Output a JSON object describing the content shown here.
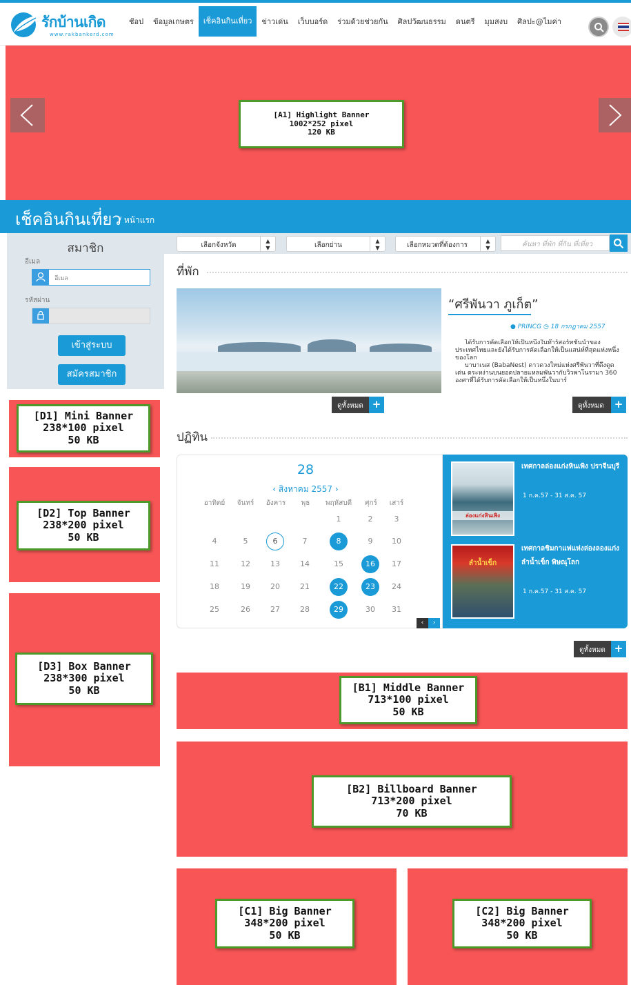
{
  "header": {
    "logo_text": "รักบ้านเกิด",
    "logo_url": "www.rakbankerd.com",
    "nav": [
      {
        "label": "ช้อป"
      },
      {
        "label": "ข้อมูลเกษตร"
      },
      {
        "label": "เช็คอินกินเที่ยว",
        "active": true
      },
      {
        "label": "ข่าวเด่น"
      },
      {
        "label": "เว็บบอร์ด"
      },
      {
        "label": "ร่วมด้วยช่วยกัน"
      },
      {
        "label": "ศิลปวัฒนธรรม"
      },
      {
        "label": "ดนตรี"
      },
      {
        "label": "มุมสงบ"
      },
      {
        "label": "ศิลปะ@ไมค่า"
      }
    ],
    "search_icon": "search-icon",
    "language_icon": "thai-flag-icon"
  },
  "banners": {
    "A1": {
      "name": "[A1] Highlight Banner",
      "size": "1002*252 pixel",
      "weight": "120 KB"
    },
    "D1": {
      "name": "[D1] Mini Banner",
      "size": "238*100 pixel",
      "weight": "50 KB"
    },
    "D2": {
      "name": "[D2] Top Banner",
      "size": "238*200 pixel",
      "weight": "50 KB"
    },
    "D3": {
      "name": "[D3] Box Banner",
      "size": "238*300 pixel",
      "weight": "50 KB"
    },
    "B1": {
      "name": "[B1] Middle Banner",
      "size": "713*100 pixel",
      "weight": "50 KB"
    },
    "B2": {
      "name": "[B2] Billboard Banner",
      "size": "713*200 pixel",
      "weight": "70 KB"
    },
    "C1": {
      "name": "[C1] Big Banner",
      "size": "348*200 pixel",
      "weight": "50 KB"
    },
    "C2": {
      "name": "[C2] Big Banner",
      "size": "348*200 pixel",
      "weight": "50 KB"
    }
  },
  "page": {
    "title": "เช็คอินกินเที่ยว",
    "breadcrumb": "/ หน้าแรก"
  },
  "member": {
    "title": "สมาชิก",
    "email_label": "อีเมล",
    "email_placeholder": "อีเมล",
    "password_label": "รหัสผ่าน",
    "login_label": "เข้าสู่ระบบ",
    "register_label": "สมัครสมาชิก"
  },
  "filters": {
    "province": "เลือกจังหวัด",
    "area": "เลือกย่าน",
    "category": "เลือกหมวดที่ต้องการ",
    "search_placeholder": "ค้นหา ที่พัก ที่กิน ที่เที่ยว"
  },
  "lodging": {
    "heading": "ที่พัก",
    "title": "“ศรีพันวา ภูเก็ต”",
    "author": "PRINCG",
    "date": "18 กรกฎาคม 2557",
    "body_p1": "ได้รับการคัดเลือกให้เป็นหนึ่งในท๊าร์สอร์ทชั้นนำของประเทศไทยและยังได้รับการคัดเลือกให้เป็นแสน่ห์ที่สุดแห่งหนึ่งของโลก",
    "body_p2": "บาบาเนส (BabaNest) ดาวดวงใหม่แห่งศรีพันวาที่ดึงดูดเด่น ตระหง่านบนยอดปลายแหลมพันวากับวิวพาโนรามา 360 องศาที่ได้รับการคัดเลือกให้เป็นหนึ่งในบาร์",
    "more_label": "ดูทั้งหมด",
    "more_label_2": "ดูทั้งหมด"
  },
  "calendar": {
    "heading": "ปฏิทิน",
    "day": "28",
    "month": "‹ สิงหาคม 2557 ›",
    "weekdays": [
      "อาทิตย์",
      "จันทร์",
      "อังคาร",
      "พุธ",
      "พฤหัสบดี",
      "ศุกร์",
      "เสาร์"
    ],
    "dates": [
      [
        "",
        "",
        "",
        "",
        "1",
        "2",
        "3"
      ],
      [
        "4",
        "5",
        "6",
        "7",
        "8",
        "9",
        "10"
      ],
      [
        "11",
        "12",
        "13",
        "14",
        "15",
        "16",
        "17"
      ],
      [
        "18",
        "19",
        "20",
        "21",
        "22",
        "23",
        "24"
      ],
      [
        "25",
        "26",
        "27",
        "28",
        "29",
        "30",
        "31"
      ]
    ],
    "highlighted": [
      "8",
      "16",
      "22",
      "23",
      "29"
    ],
    "today": "6",
    "prev": "‹",
    "next": "›",
    "more_label": "ดูทั้งหมด"
  },
  "events": [
    {
      "title": "เทศกาลล่องแก่งหินเพิง ปราจีนบุรี",
      "date": "1 ก.ค.57 - 31 ส.ค. 57",
      "poster_text": "ล่องแก่งหินเพิง"
    },
    {
      "title": "เทศกาลชิมกาแฟแห่งล่องลองแก่งลำน้ำเข็ก พิษณุโลก",
      "date": "1 ก.ค.57 - 31 ส.ค. 57",
      "poster_text": "ลำน้ำเข็ก"
    }
  ],
  "colors": {
    "brand_blue": "#1a9ad6",
    "banner_red": "#f85656",
    "label_border": "#4d9a2a"
  }
}
